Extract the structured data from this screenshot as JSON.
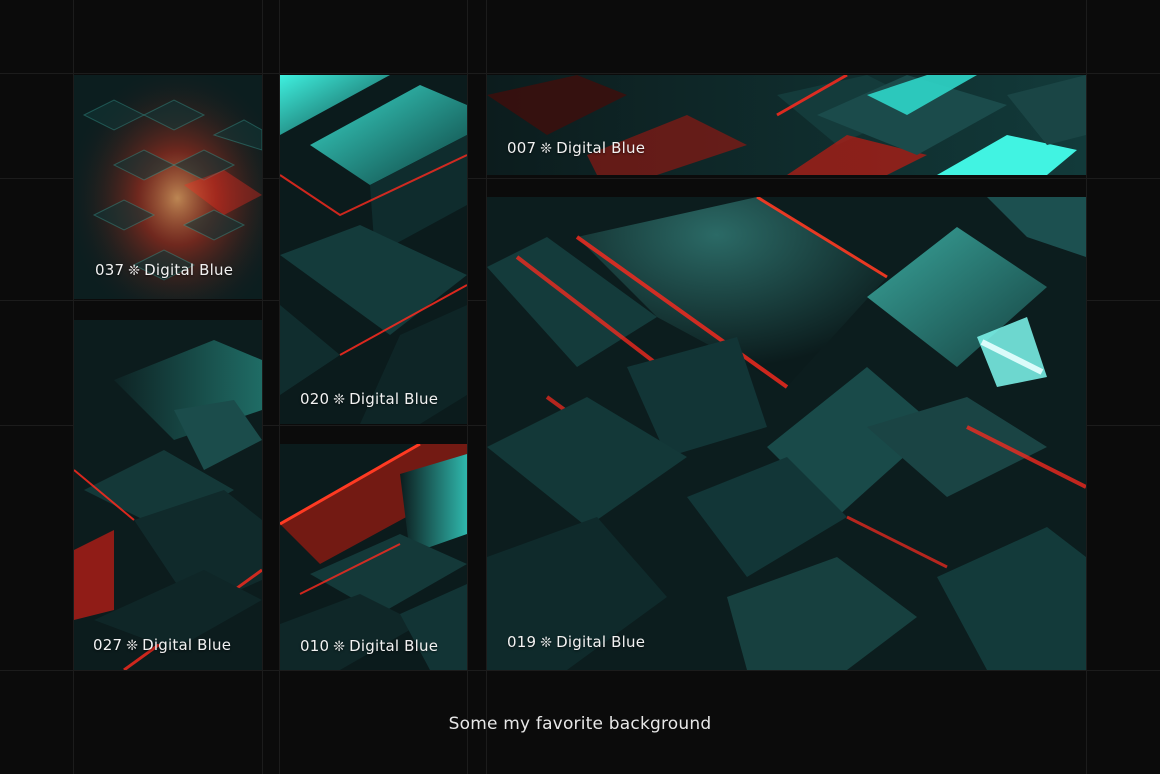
{
  "tiles": {
    "t037": {
      "number": "037",
      "separator": "❊",
      "name": "Digital Blue"
    },
    "t020": {
      "number": "020",
      "separator": "❊",
      "name": "Digital Blue"
    },
    "t007": {
      "number": "007",
      "separator": "❊",
      "name": "Digital Blue"
    },
    "t027": {
      "number": "027",
      "separator": "❊",
      "name": "Digital Blue"
    },
    "t010": {
      "number": "010",
      "separator": "❊",
      "name": "Digital Blue"
    },
    "t019": {
      "number": "019",
      "separator": "❊",
      "name": "Digital Blue"
    }
  },
  "caption": "Some my favorite background",
  "colors": {
    "background": "#0b0b0b",
    "teal": "#2fd6c9",
    "red": "#ff2a1e",
    "dark_teal": "#0f2a2b"
  }
}
